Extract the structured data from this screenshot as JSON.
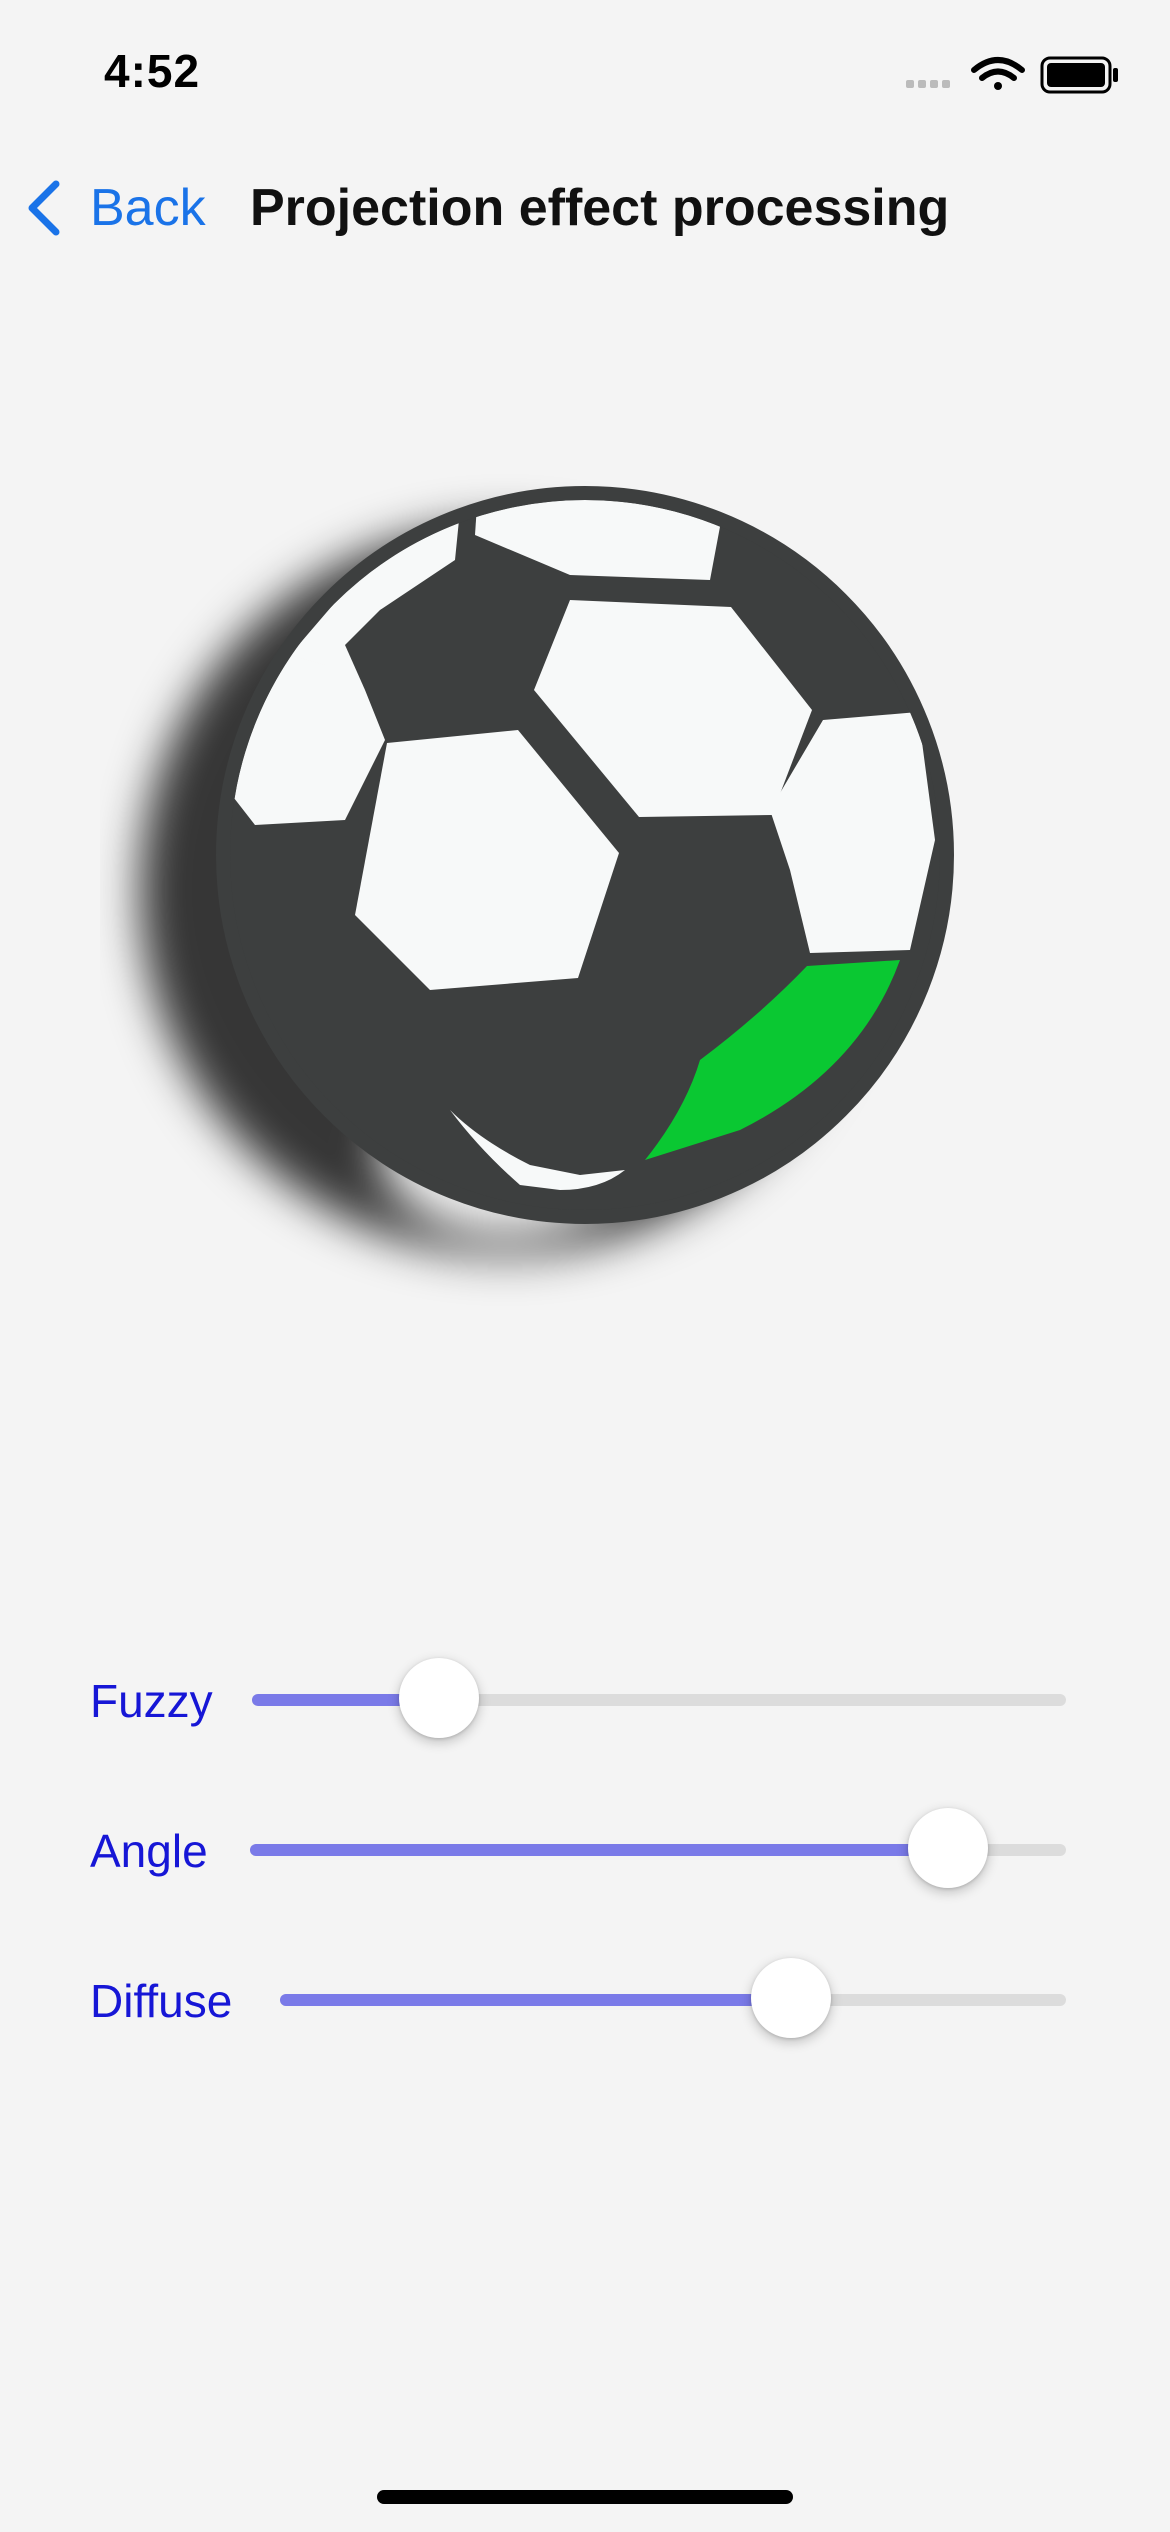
{
  "status_bar": {
    "time": "4:52",
    "icons": [
      "signal-icon",
      "wifi-icon",
      "battery-icon"
    ]
  },
  "nav": {
    "back_label": "Back",
    "title": "Projection effect processing"
  },
  "sliders": [
    {
      "label": "Fuzzy",
      "value": 0.23
    },
    {
      "label": "Angle",
      "value": 0.855
    },
    {
      "label": "Diffuse",
      "value": 0.65
    }
  ],
  "colors": {
    "accent_blue": "#1a73e8",
    "label_blue": "#1616d6",
    "slider_fill": "#7a7ae8",
    "ball_dark": "#3d3f3f",
    "ball_green": "#0ac832"
  }
}
